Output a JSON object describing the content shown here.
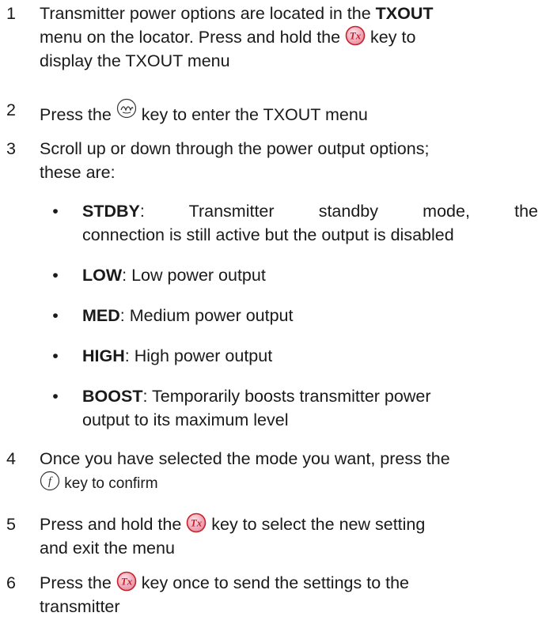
{
  "steps": [
    {
      "num": "1",
      "line1_a": "Transmitter power options are located in the ",
      "line1_bold": "TXOUT",
      "line2_a": "menu on the locator. Press and hold the ",
      "line2_b": " key to",
      "line3": "display the TXOUT menu"
    },
    {
      "num": "2",
      "a": "Press the ",
      "b": " key to enter the TXOUT menu"
    },
    {
      "num": "3",
      "line1": "Scroll up or down through the power output options;",
      "line2": "these are:"
    },
    {
      "num": "4",
      "line1": "Once you have selected the mode you want, press the",
      "line2": " key to confirm"
    },
    {
      "num": "5",
      "line1_a": "Press and hold the ",
      "line1_b": " key to select the new setting",
      "line2": "and exit the menu"
    },
    {
      "num": "6",
      "line1_a": "Press the ",
      "line1_b": " key once to send the settings to the",
      "line2": "transmitter"
    }
  ],
  "options": [
    {
      "bullet": "•",
      "name": "STDBY",
      "desc_line1": ": Transmitter standby mode, the",
      "desc_line2": "connection is still active but the output is disabled"
    },
    {
      "bullet": "•",
      "name": "LOW",
      "desc": ": Low power output"
    },
    {
      "bullet": "•",
      "name": "MED",
      "desc": ": Medium power output"
    },
    {
      "bullet": "•",
      "name": "HIGH",
      "desc": ": High power output"
    },
    {
      "bullet": "•",
      "name": "BOOST",
      "desc_line1": ": Temporarily boosts transmitter power",
      "desc_line2": "output to its maximum level"
    }
  ],
  "icons": {
    "tx_key": "tx-key-icon",
    "enter_key": "antenna-key-icon",
    "function_key": "function-key-icon",
    "tx_label": "Tx",
    "function_label": "f",
    "tx_color": "#c8202a",
    "tx_fill": "#f3b6c0"
  }
}
